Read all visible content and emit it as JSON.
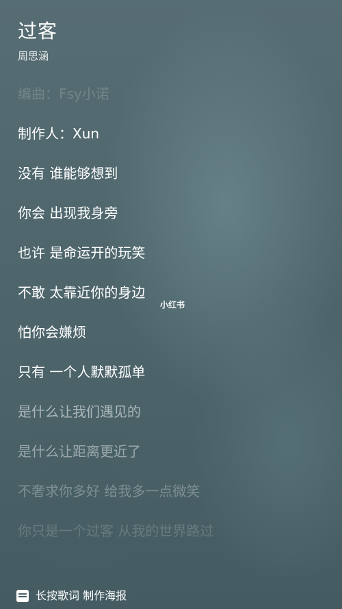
{
  "song": {
    "title": "过客",
    "artist": "周思涵"
  },
  "lyrics": [
    "编曲：Fsy小诺",
    "制作人：Xun",
    "没有 谁能够想到",
    "你会 出现我身旁",
    "也许 是命运开的玩笑",
    "不敢 太靠近你的身边",
    "怕你会嫌烦",
    "只有 一个人默默孤单",
    "是什么让我们遇见的",
    "是什么让距离更近了",
    "不奢求你多好 给我多一点微笑",
    "你只是一个过客 从我的世界路过"
  ],
  "watermark": "小红书",
  "footer": {
    "icon": "poster-icon",
    "label": "长按歌词 制作海报"
  }
}
